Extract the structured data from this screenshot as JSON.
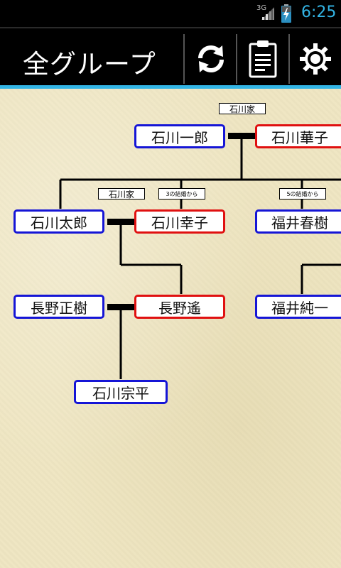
{
  "status_bar": {
    "network": "3G",
    "time": "6:25",
    "accent_color": "#33b5e5"
  },
  "action_bar": {
    "title": "全グループ",
    "actions": [
      {
        "name": "refresh",
        "icon": "refresh-icon"
      },
      {
        "name": "clipboard",
        "icon": "clipboard-icon"
      },
      {
        "name": "settings",
        "icon": "gear-icon"
      }
    ]
  },
  "tree": {
    "tags": {
      "ishikawa_top": "石川家",
      "ishikawa_mid": "石川家",
      "marriage_3": "3の結婚から",
      "marriage_5": "5の結婚から"
    },
    "people": {
      "ishikawa_ichiro": "石川一郎",
      "ishikawa_hanako": "石川華子",
      "ishikawa_taro": "石川太郎",
      "ishikawa_sachiko": "石川幸子",
      "fukui_haruki": "福井春樹",
      "nagano_masaki": "長野正樹",
      "nagano_haruka": "長野遙",
      "fukui_junichi": "福井純一",
      "ishikawa_souhei": "石川宗平"
    },
    "colors": {
      "male_border": "#1515d6",
      "female_border": "#e01010"
    }
  }
}
